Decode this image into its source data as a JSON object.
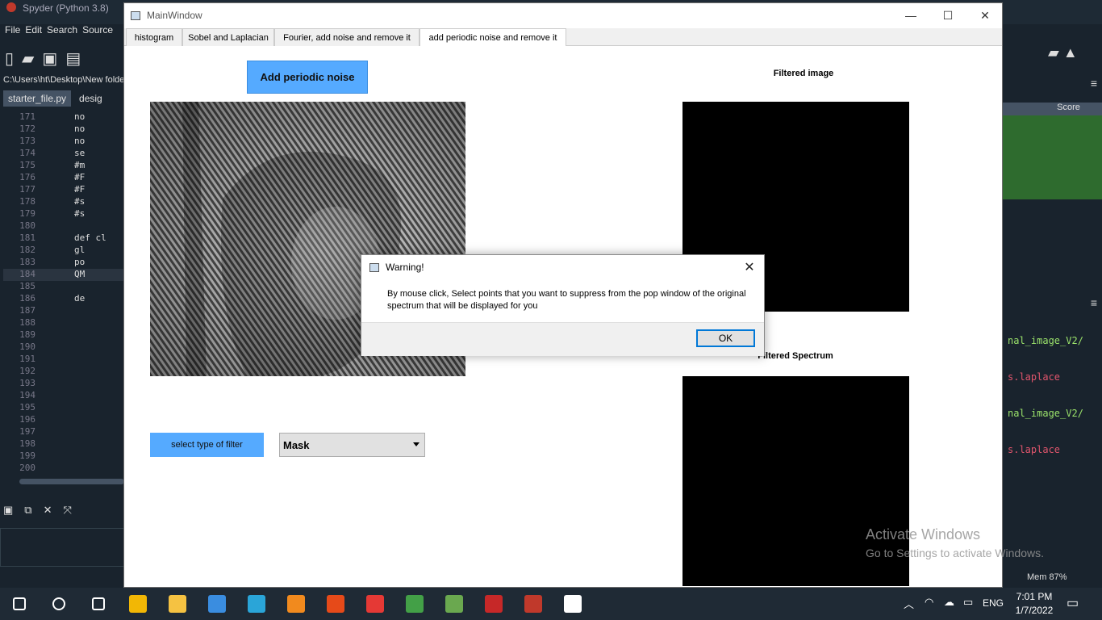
{
  "spyder": {
    "title": "Spyder (Python 3.8)",
    "menu": [
      "File",
      "Edit",
      "Search",
      "Source"
    ],
    "path": "C:\\Users\\ht\\Desktop\\New folde",
    "tabs": [
      "starter_file.py",
      "desig"
    ],
    "lines": [
      {
        "n": "171",
        "c": "no"
      },
      {
        "n": "172",
        "c": "no"
      },
      {
        "n": "173",
        "c": "no"
      },
      {
        "n": "174",
        "c": "se"
      },
      {
        "n": "175",
        "c": "#m"
      },
      {
        "n": "176",
        "c": "#F"
      },
      {
        "n": "177",
        "c": "#F"
      },
      {
        "n": "178",
        "c": "#s"
      },
      {
        "n": "179",
        "c": "#s"
      },
      {
        "n": "180",
        "c": ""
      },
      {
        "n": "181",
        "c": "def cl"
      },
      {
        "n": "182",
        "c": "gl"
      },
      {
        "n": "183",
        "c": "po"
      },
      {
        "n": "184",
        "c": "QM"
      },
      {
        "n": "185",
        "c": ""
      },
      {
        "n": "186",
        "c": "de"
      },
      {
        "n": "187",
        "c": ""
      },
      {
        "n": "188",
        "c": ""
      },
      {
        "n": "189",
        "c": ""
      },
      {
        "n": "190",
        "c": ""
      },
      {
        "n": "191",
        "c": ""
      },
      {
        "n": "192",
        "c": ""
      },
      {
        "n": "193",
        "c": ""
      },
      {
        "n": "194",
        "c": ""
      },
      {
        "n": "195",
        "c": ""
      },
      {
        "n": "196",
        "c": ""
      },
      {
        "n": "197",
        "c": ""
      },
      {
        "n": "198",
        "c": ""
      },
      {
        "n": "199",
        "c": ""
      },
      {
        "n": "200",
        "c": ""
      }
    ],
    "current_line": "184",
    "var_header": "Score",
    "code_frags": [
      "nal_image_V2/",
      "s.laplace",
      "nal_image_V2/",
      "s.laplace"
    ],
    "memory": "Mem 87%"
  },
  "window": {
    "title": "MainWindow",
    "tabs": [
      "histogram",
      "Sobel and Laplacian",
      "Fourier, add noise and remove it",
      "add periodic noise and remove it"
    ],
    "active_tab": 3
  },
  "content": {
    "add_noise_button": "Add periodic noise",
    "filtered_label": "Filtered image",
    "spectrum_label": "Filtered Spectrum",
    "filter_button": "select type of filter",
    "filter_selected": "Mask"
  },
  "dialog": {
    "title": "Warning!",
    "message": "By mouse click, Select points that you want to suppress from the pop window of the original spectrum that will be displayed for you",
    "ok": "OK"
  },
  "watermark": {
    "line1": "Activate Windows",
    "line2": "Go to Settings to activate Windows."
  },
  "taskbar": {
    "time": "7:01 PM",
    "date": "1/7/2022",
    "lang": "ENG",
    "apps": [
      {
        "icon": "start-icon",
        "color": "#ffffff"
      },
      {
        "icon": "search-icon",
        "color": "#ffffff"
      },
      {
        "icon": "task-view-icon",
        "color": "#ffffff"
      },
      {
        "icon": "store-icon",
        "color": "#f2b705"
      },
      {
        "icon": "file-explorer-icon",
        "color": "#f5c242"
      },
      {
        "icon": "mail-icon",
        "color": "#3a8de0"
      },
      {
        "icon": "edge-icon",
        "color": "#2aa5d8"
      },
      {
        "icon": "sublime-icon",
        "color": "#f18a1e"
      },
      {
        "icon": "office-icon",
        "color": "#e64a19"
      },
      {
        "icon": "chrome-icon",
        "color": "#e53935"
      },
      {
        "icon": "anaconda-icon",
        "color": "#43a047"
      },
      {
        "icon": "git-icon",
        "color": "#6aa84f"
      },
      {
        "icon": "sketchup-icon",
        "color": "#c62828"
      },
      {
        "icon": "spyder-icon",
        "color": "#c0392b"
      },
      {
        "icon": "notepad-icon",
        "color": "#ffffff"
      }
    ]
  }
}
